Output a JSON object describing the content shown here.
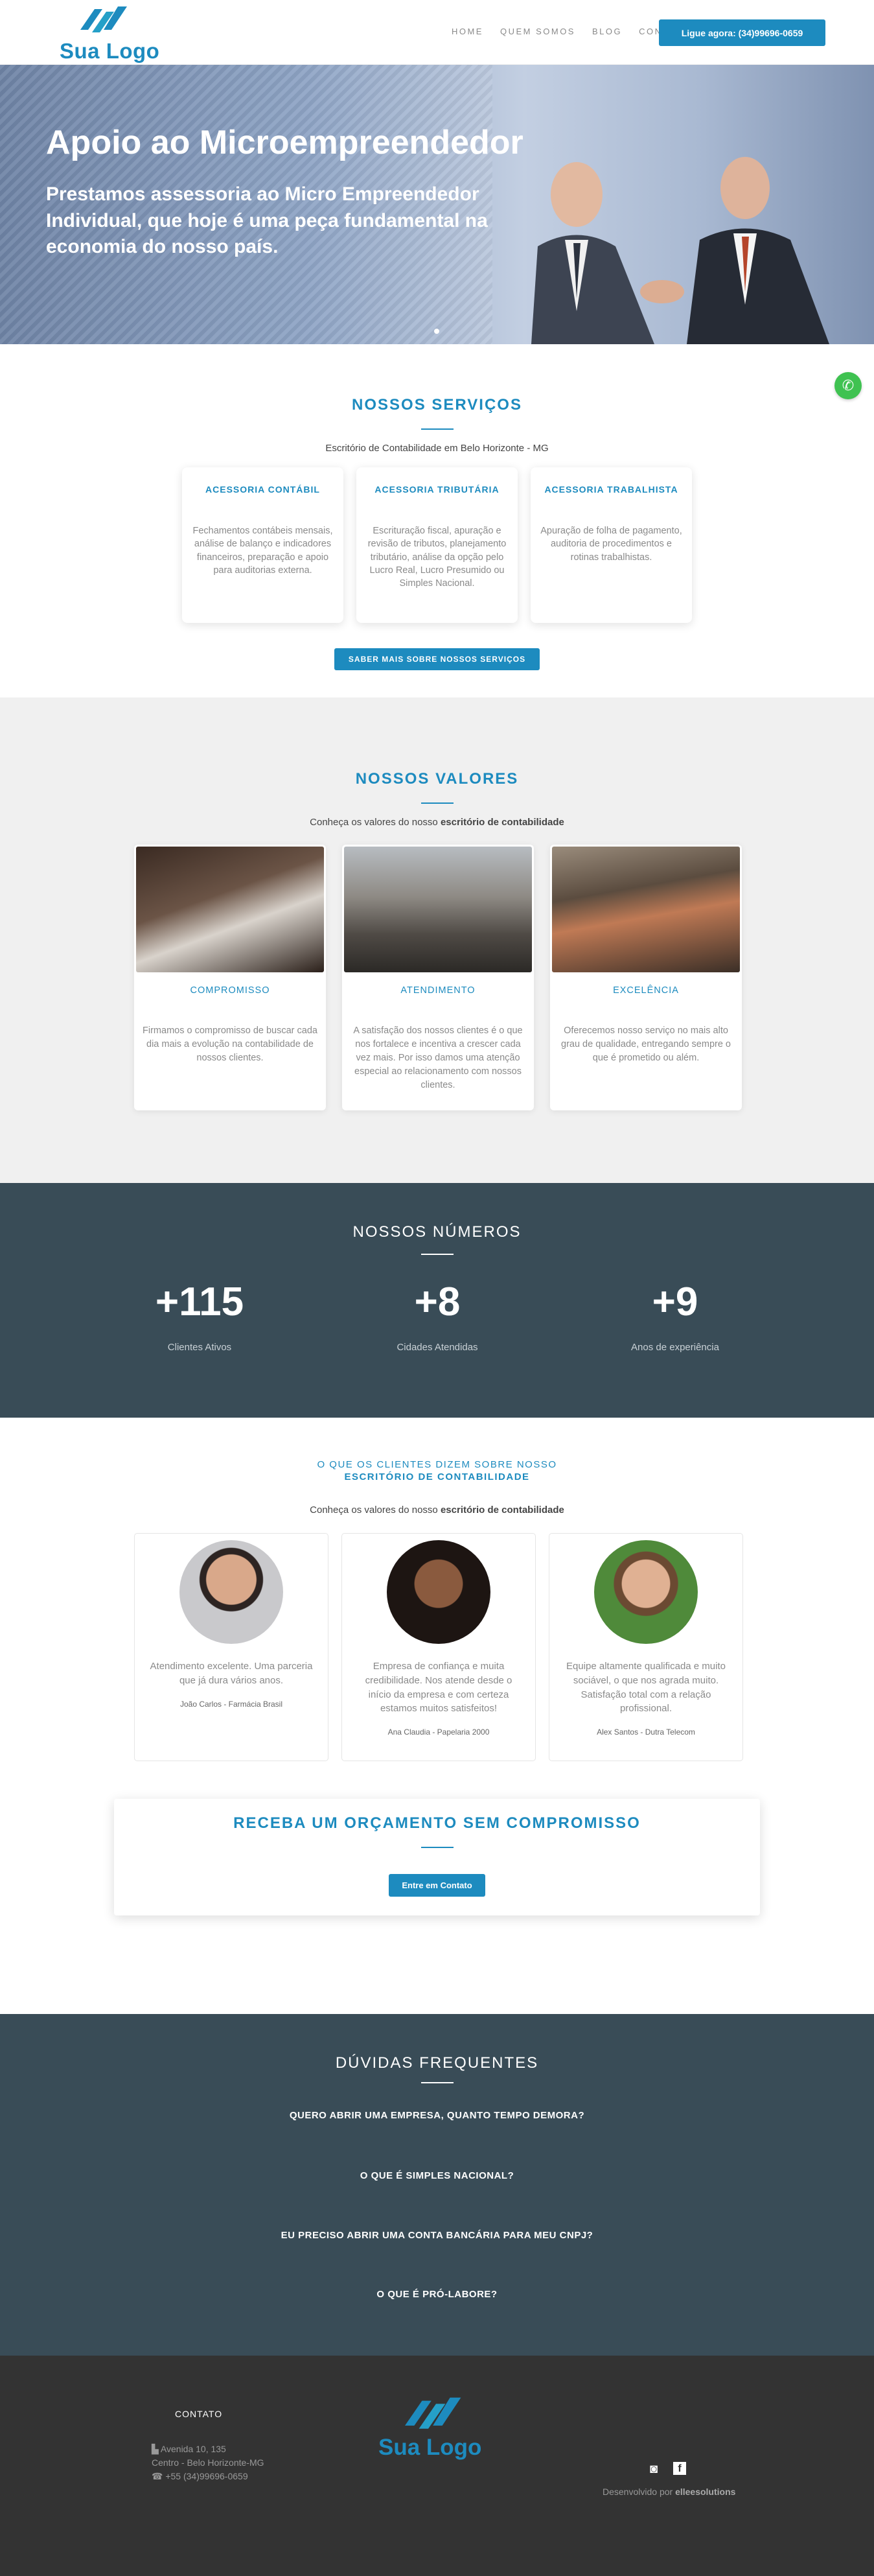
{
  "header": {
    "logo_text": "Sua Logo",
    "nav": [
      "HOME",
      "QUEM SOMOS",
      "BLOG",
      "CONTATO"
    ],
    "call_button": "Ligue agora: (34)99696-0659"
  },
  "hero": {
    "title": "Apoio ao Microempreendedor",
    "subtitle": "Prestamos assessoria ao Micro Empreendedor Individual, que hoje é uma peça fundamental na economia do nosso país."
  },
  "services": {
    "title": "NOSSOS SERVIÇOS",
    "subtitle": "Escritório de Contabilidade em Belo Horizonte - MG",
    "cards": [
      {
        "title": "ACESSORIA CONTÁBIL",
        "text": "Fechamentos contábeis mensais, análise de balanço e indicadores financeiros, preparação e apoio para auditorias externa."
      },
      {
        "title": "ACESSORIA TRIBUTÁRIA",
        "text": "Escrituração fiscal, apuração e revisão de tributos, planejamento tributário, análise da opção pelo Lucro Real, Lucro Presumido ou Simples Nacional."
      },
      {
        "title": "ACESSORIA TRABALHISTA",
        "text": "Apuração de folha de pagamento, auditoria de procedimentos e rotinas trabalhistas."
      }
    ],
    "button": "SABER MAIS SOBRE NOSSOS SERVIÇOS"
  },
  "values": {
    "title": "NOSSOS VALORES",
    "subtitle_plain": "Conheça os valores do nosso ",
    "subtitle_bold": "escritório de contabilidade",
    "cards": [
      {
        "title": "COMPROMISSO",
        "text": "Firmamos o compromisso de buscar cada dia mais a evolução na contabilidade de nossos clientes."
      },
      {
        "title": "ATENDIMENTO",
        "text": "A satisfação dos nossos clientes é o que nos fortalece e incentiva a crescer cada vez mais. Por isso damos uma atenção especial ao relacionamento com nossos clientes."
      },
      {
        "title": "EXCELÊNCIA",
        "text": "Oferecemos nosso serviço no mais alto grau de qualidade, entregando sempre o que é prometido ou além."
      }
    ]
  },
  "numbers": {
    "title": "NOSSOS NÚMEROS",
    "items": [
      {
        "value": "+115",
        "label": "Clientes Ativos"
      },
      {
        "value": "+8",
        "label": "Cidades Atendidas"
      },
      {
        "value": "+9",
        "label": "Anos de experiência"
      }
    ]
  },
  "testimonials": {
    "kicker": "O QUE OS CLIENTES DIZEM SOBRE NOSSO",
    "kicker_bold": "ESCRITÓRIO DE CONTABILIDADE",
    "subtitle_plain": "Conheça os valores do nosso ",
    "subtitle_bold": "escritório de contabilidade",
    "items": [
      {
        "text": "Atendimento excelente. Uma parceria que já dura vários anos.",
        "author": "João Carlos - Farmácia Brasil"
      },
      {
        "text": "Empresa de confiança e muita credibilidade. Nos atende desde o início da empresa e com certeza estamos muitos satisfeitos!",
        "author": "Ana Claudia - Papelaria 2000"
      },
      {
        "text": "Equipe altamente qualificada e muito sociável, o que nos agrada muito. Satisfação total com a relação profissional.",
        "author": "Alex Santos - Dutra Telecom"
      }
    ]
  },
  "quote": {
    "title": "RECEBA UM ORÇAMENTO SEM COMPROMISSO",
    "button": "Entre em Contato"
  },
  "faq": {
    "title": "DÚVIDAS FREQUENTES",
    "questions": [
      "QUERO ABRIR UMA EMPRESA, QUANTO TEMPO DEMORA?",
      "O QUE É SIMPLES NACIONAL?",
      "EU PRECISO ABRIR UMA CONTA BANCÁRIA PARA MEU CNPJ?",
      "O QUE É PRÓ-LABORE?"
    ]
  },
  "footer": {
    "contact_title": "CONTATO",
    "address1": "Avenida 10, 135",
    "address2": "Centro - Belo Horizonte-MG",
    "phone": "+55 (34)99696-0659",
    "logo_text": "Sua Logo",
    "dev_plain": "Desenvolvido por ",
    "dev_bold": "elleesolutions"
  },
  "colors": {
    "accent": "#1d8bbf",
    "dark": "#394c57",
    "footer": "#333333",
    "whatsapp": "#3fc251"
  }
}
